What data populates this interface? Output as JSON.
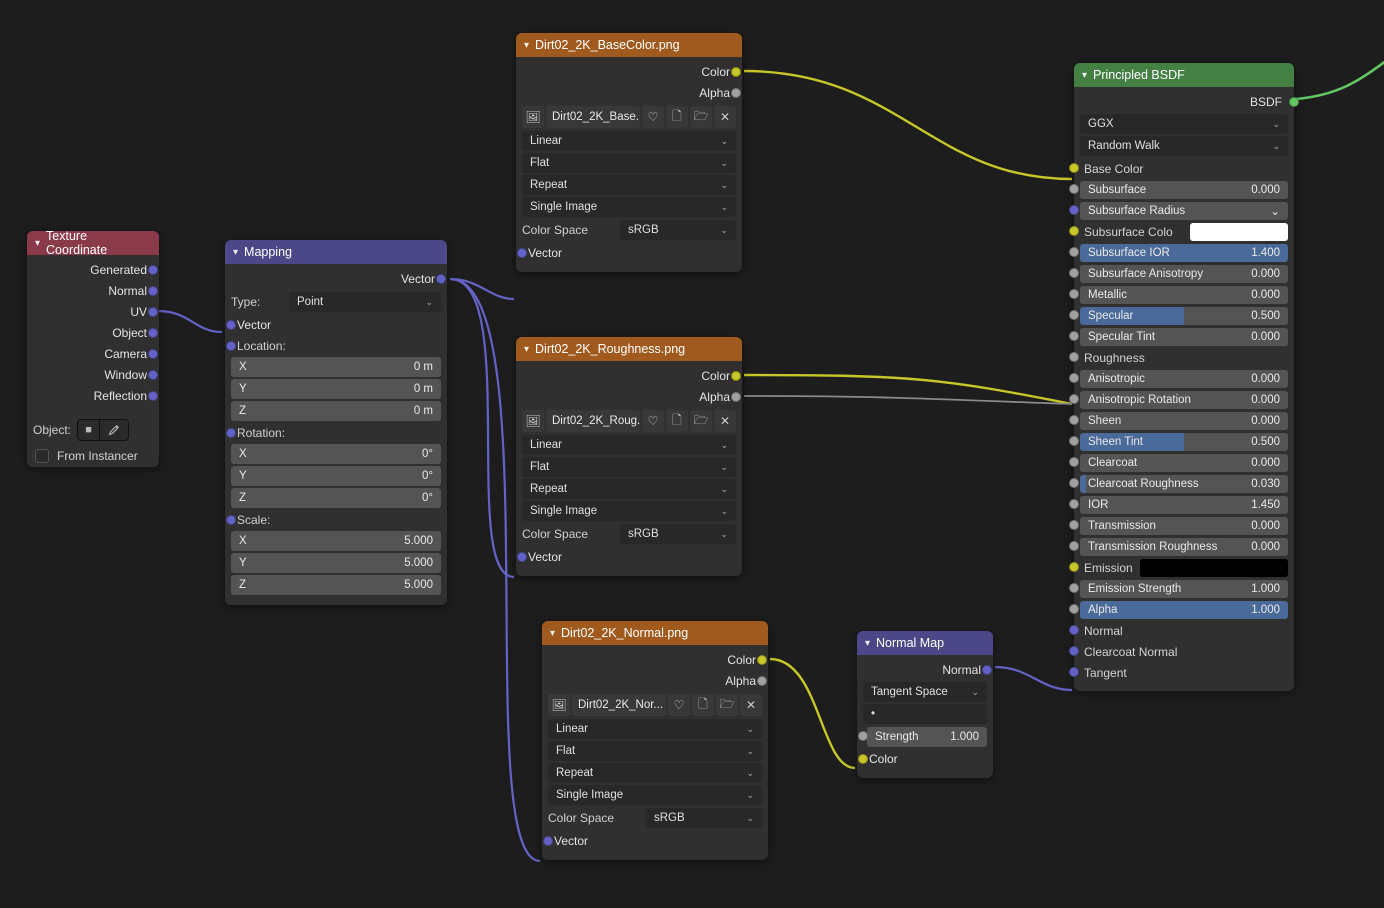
{
  "texcoord": {
    "title": "Texture Coordinate",
    "outputs": [
      "Generated",
      "Normal",
      "UV",
      "Object",
      "Camera",
      "Window",
      "Reflection"
    ],
    "object_label": "Object:",
    "from_instancer": "From Instancer"
  },
  "mapping": {
    "title": "Mapping",
    "out_vector": "Vector",
    "type_label": "Type:",
    "type_value": "Point",
    "in_vector": "Vector",
    "location_label": "Location:",
    "rotation_label": "Rotation:",
    "scale_label": "Scale:",
    "loc": [
      {
        "a": "X",
        "v": "0 m"
      },
      {
        "a": "Y",
        "v": "0 m"
      },
      {
        "a": "Z",
        "v": "0 m"
      }
    ],
    "rot": [
      {
        "a": "X",
        "v": "0°"
      },
      {
        "a": "Y",
        "v": "0°"
      },
      {
        "a": "Z",
        "v": "0°"
      }
    ],
    "scale": [
      {
        "a": "X",
        "v": "5.000"
      },
      {
        "a": "Y",
        "v": "5.000"
      },
      {
        "a": "Z",
        "v": "5.000"
      }
    ]
  },
  "img_common": {
    "out_color": "Color",
    "out_alpha": "Alpha",
    "interpolation": "Linear",
    "projection": "Flat",
    "wrap": "Repeat",
    "frame": "Single Image",
    "colorspace_label": "Color Space",
    "colorspace_value": "sRGB",
    "in_vector": "Vector"
  },
  "img_base": {
    "title": "Dirt02_2K_BaseColor.png",
    "file": "Dirt02_2K_Base..."
  },
  "img_rough": {
    "title": "Dirt02_2K_Roughness.png",
    "file": "Dirt02_2K_Roug..."
  },
  "img_normal": {
    "title": "Dirt02_2K_Normal.png",
    "file": "Dirt02_2K_Nor..."
  },
  "normalmap": {
    "title": "Normal Map",
    "out_normal": "Normal",
    "space": "Tangent Space",
    "strength_label": "Strength",
    "strength_value": "1.000",
    "in_color": "Color",
    "uvmap": "•"
  },
  "bsdf": {
    "title": "Principled BSDF",
    "out": "BSDF",
    "dist": "GGX",
    "sss": "Random Walk",
    "base_color": "Base Color",
    "rows": [
      {
        "name": "Subsurface",
        "val": "0.000",
        "fill": 0
      },
      {
        "name": "Subsurface Radius",
        "val": "",
        "dd": true
      },
      {
        "name": "Subsurface Colo",
        "val": "",
        "color": "white"
      },
      {
        "name": "Subsurface IOR",
        "val": "1.400",
        "fill": 100
      },
      {
        "name": "Subsurface Anisotropy",
        "val": "0.000",
        "fill": 0
      },
      {
        "name": "Metallic",
        "val": "0.000",
        "fill": 0
      },
      {
        "name": "Specular",
        "val": "0.500",
        "fill": 50
      },
      {
        "name": "Specular Tint",
        "val": "0.000",
        "fill": 0
      }
    ],
    "roughness": "Roughness",
    "rows2": [
      {
        "name": "Anisotropic",
        "val": "0.000",
        "fill": 0
      },
      {
        "name": "Anisotropic Rotation",
        "val": "0.000",
        "fill": 0
      },
      {
        "name": "Sheen",
        "val": "0.000",
        "fill": 0
      },
      {
        "name": "Sheen Tint",
        "val": "0.500",
        "fill": 50
      },
      {
        "name": "Clearcoat",
        "val": "0.000",
        "fill": 0
      },
      {
        "name": "Clearcoat Roughness",
        "val": "0.030",
        "fill": 3
      },
      {
        "name": "IOR",
        "val": "1.450",
        "fill": 0
      },
      {
        "name": "Transmission",
        "val": "0.000",
        "fill": 0
      },
      {
        "name": "Transmission Roughness",
        "val": "0.000",
        "fill": 0
      }
    ],
    "emission": "Emission",
    "rows3": [
      {
        "name": "Emission Strength",
        "val": "1.000",
        "fill": 0
      },
      {
        "name": "Alpha",
        "val": "1.000",
        "fill": 100
      }
    ],
    "plain": [
      "Normal",
      "Clearcoat Normal",
      "Tangent"
    ]
  }
}
